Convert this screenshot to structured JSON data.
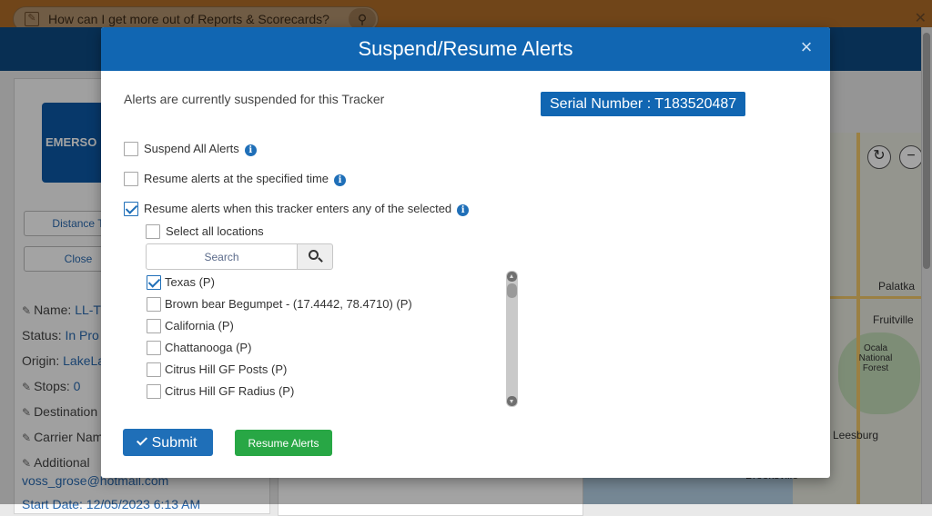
{
  "background": {
    "help_search_text": "How can I get more out of Reports & Scorecards?",
    "logo_text": "EMERSO",
    "buttons": {
      "distance": "Distance T",
      "close": "Close"
    },
    "info": {
      "name_label": "Name:",
      "name_value": "LL-T",
      "status_label": "Status:",
      "status_value": "In Pro",
      "origin_label": "Origin:",
      "origin_value": "LakeLa",
      "stops_label": "Stops:",
      "stops_value": "0",
      "destination_label": "Destination",
      "carrier_label": "Carrier Nam",
      "additional_label": "Additional",
      "email": "voss_grose@hotmail.com",
      "start_date": "Start Date: 12/05/2023 6:13 AM"
    },
    "map_labels": [
      "Palatka",
      "Fruitville",
      "Ocala National Forest",
      "Leesburg",
      "Brooksville"
    ]
  },
  "modal": {
    "title": "Suspend/Resume Alerts",
    "close_symbol": "×",
    "status_text": "Alerts are currently suspended for this Tracker",
    "serial_badge": "Serial Number : T183520487",
    "options": {
      "suspend_all": {
        "label": "Suspend All Alerts",
        "checked": false
      },
      "resume_time": {
        "label": "Resume alerts at the specified time",
        "checked": false
      },
      "resume_enter": {
        "label": "Resume alerts when this tracker enters any of the selected",
        "checked": true
      }
    },
    "select_all_label": "Select all locations",
    "search_placeholder": "Search",
    "locations": [
      {
        "label": "Texas (P)",
        "checked": true
      },
      {
        "label": "Brown bear Begumpet - (17.4442, 78.4710) (P)",
        "checked": false
      },
      {
        "label": "California (P)",
        "checked": false
      },
      {
        "label": "Chattanooga (P)",
        "checked": false
      },
      {
        "label": "Citrus Hill GF Posts (P)",
        "checked": false
      },
      {
        "label": "Citrus Hill GF Radius (P)",
        "checked": false
      }
    ],
    "submit_label": "Submit",
    "resume_button_label": "Resume Alerts"
  },
  "colors": {
    "header_blue": "#1166b2",
    "submit_blue": "#1f6fb8",
    "resume_green": "#28a745"
  }
}
